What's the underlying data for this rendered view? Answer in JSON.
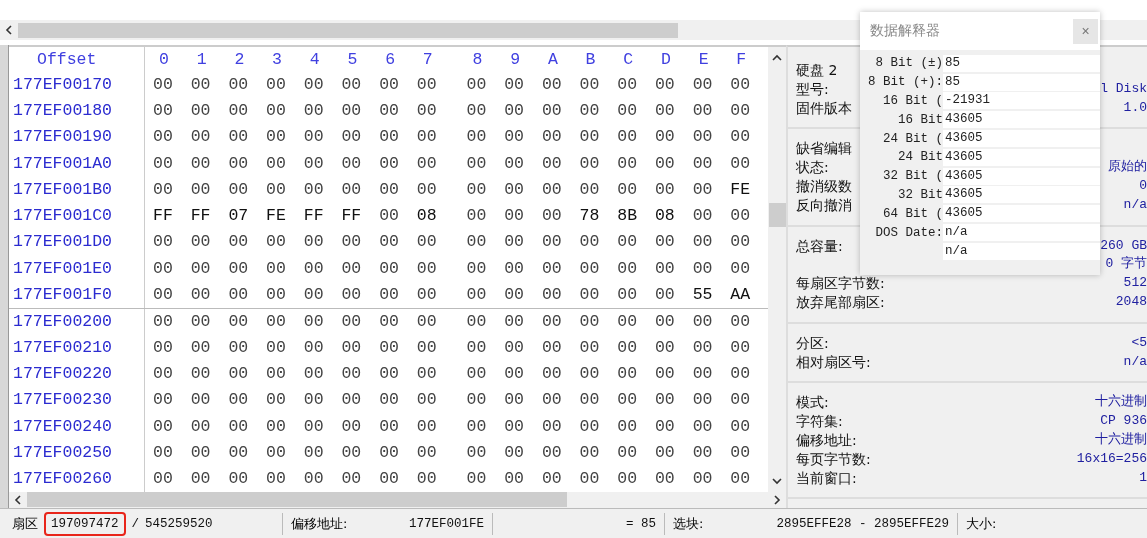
{
  "hex_view": {
    "header": "Offset",
    "columns": [
      "0",
      "1",
      "2",
      "3",
      "4",
      "5",
      "6",
      "7",
      "8",
      "9",
      "A",
      "B",
      "C",
      "D",
      "E",
      "F"
    ],
    "rows": [
      {
        "offset": "177EF00170",
        "bytes": [
          "00",
          "00",
          "00",
          "00",
          "00",
          "00",
          "00",
          "00",
          "00",
          "00",
          "00",
          "00",
          "00",
          "00",
          "00",
          "00"
        ]
      },
      {
        "offset": "177EF00180",
        "bytes": [
          "00",
          "00",
          "00",
          "00",
          "00",
          "00",
          "00",
          "00",
          "00",
          "00",
          "00",
          "00",
          "00",
          "00",
          "00",
          "00"
        ]
      },
      {
        "offset": "177EF00190",
        "bytes": [
          "00",
          "00",
          "00",
          "00",
          "00",
          "00",
          "00",
          "00",
          "00",
          "00",
          "00",
          "00",
          "00",
          "00",
          "00",
          "00"
        ]
      },
      {
        "offset": "177EF001A0",
        "bytes": [
          "00",
          "00",
          "00",
          "00",
          "00",
          "00",
          "00",
          "00",
          "00",
          "00",
          "00",
          "00",
          "00",
          "00",
          "00",
          "00"
        ]
      },
      {
        "offset": "177EF001B0",
        "bytes": [
          "00",
          "00",
          "00",
          "00",
          "00",
          "00",
          "00",
          "00",
          "00",
          "00",
          "00",
          "00",
          "00",
          "00",
          "00",
          "FE"
        ]
      },
      {
        "offset": "177EF001C0",
        "bytes": [
          "FF",
          "FF",
          "07",
          "FE",
          "FF",
          "FF",
          "00",
          "08",
          "00",
          "00",
          "00",
          "78",
          "8B",
          "08",
          "00",
          "00"
        ]
      },
      {
        "offset": "177EF001D0",
        "bytes": [
          "00",
          "00",
          "00",
          "00",
          "00",
          "00",
          "00",
          "00",
          "00",
          "00",
          "00",
          "00",
          "00",
          "00",
          "00",
          "00"
        ]
      },
      {
        "offset": "177EF001E0",
        "bytes": [
          "00",
          "00",
          "00",
          "00",
          "00",
          "00",
          "00",
          "00",
          "00",
          "00",
          "00",
          "00",
          "00",
          "00",
          "00",
          "00"
        ]
      },
      {
        "offset": "177EF001F0",
        "bytes": [
          "00",
          "00",
          "00",
          "00",
          "00",
          "00",
          "00",
          "00",
          "00",
          "00",
          "00",
          "00",
          "00",
          "00",
          "55",
          "AA"
        ]
      },
      {
        "offset": "177EF00200",
        "bytes": [
          "00",
          "00",
          "00",
          "00",
          "00",
          "00",
          "00",
          "00",
          "00",
          "00",
          "00",
          "00",
          "00",
          "00",
          "00",
          "00"
        ]
      },
      {
        "offset": "177EF00210",
        "bytes": [
          "00",
          "00",
          "00",
          "00",
          "00",
          "00",
          "00",
          "00",
          "00",
          "00",
          "00",
          "00",
          "00",
          "00",
          "00",
          "00"
        ]
      },
      {
        "offset": "177EF00220",
        "bytes": [
          "00",
          "00",
          "00",
          "00",
          "00",
          "00",
          "00",
          "00",
          "00",
          "00",
          "00",
          "00",
          "00",
          "00",
          "00",
          "00"
        ]
      },
      {
        "offset": "177EF00230",
        "bytes": [
          "00",
          "00",
          "00",
          "00",
          "00",
          "00",
          "00",
          "00",
          "00",
          "00",
          "00",
          "00",
          "00",
          "00",
          "00",
          "00"
        ]
      },
      {
        "offset": "177EF00240",
        "bytes": [
          "00",
          "00",
          "00",
          "00",
          "00",
          "00",
          "00",
          "00",
          "00",
          "00",
          "00",
          "00",
          "00",
          "00",
          "00",
          "00"
        ]
      },
      {
        "offset": "177EF00250",
        "bytes": [
          "00",
          "00",
          "00",
          "00",
          "00",
          "00",
          "00",
          "00",
          "00",
          "00",
          "00",
          "00",
          "00",
          "00",
          "00",
          "00"
        ]
      },
      {
        "offset": "177EF00260",
        "bytes": [
          "00",
          "00",
          "00",
          "00",
          "00",
          "00",
          "00",
          "00",
          "00",
          "00",
          "00",
          "00",
          "00",
          "00",
          "00",
          "00"
        ]
      }
    ]
  },
  "info_panel": {
    "sections": [
      {
        "items": [
          {
            "label": "硬盘 2"
          },
          {
            "label": "型号:",
            "value": "l Disk"
          },
          {
            "label": "固件版本",
            "value": "1.0"
          }
        ]
      },
      {
        "items": [
          {
            "label": "缺省编辑"
          },
          {
            "label": "状态:",
            "value": "原始的"
          },
          {
            "label": "撤消级数",
            "value": "0"
          },
          {
            "label": "反向撤消",
            "value": "n/a"
          }
        ]
      },
      {
        "items": [
          {
            "label": "总容量:",
            "value": "260 GB"
          },
          {
            "value": "0 字节"
          },
          {
            "label": "每扇区字节数:",
            "value": "512"
          },
          {
            "label": "放弃尾部扇区:",
            "value": "2048"
          }
        ]
      },
      {
        "items": [
          {
            "label": "分区:",
            "value": "<5"
          },
          {
            "label": "相对扇区号:",
            "value": "n/a"
          }
        ]
      },
      {
        "items": [
          {
            "label": "模式:",
            "value": "十六进制"
          },
          {
            "label": "字符集:",
            "value": "CP 936"
          },
          {
            "label": "偏移地址:",
            "value": "十六进制"
          },
          {
            "label": "每页字节数:",
            "value": "16x16=256"
          },
          {
            "label": "当前窗口:",
            "value": "1"
          }
        ]
      }
    ]
  },
  "data_interpreter": {
    "title": "数据解释器",
    "close": "×",
    "rows": [
      {
        "label": "8 Bit (±)",
        "value": "85"
      },
      {
        "label": "8 Bit (+):",
        "value": "85"
      },
      {
        "label": "16 Bit (",
        "value": "-21931"
      },
      {
        "label": "16 Bit",
        "value": "43605"
      },
      {
        "label": "24 Bit (",
        "value": "43605"
      },
      {
        "label": "24 Bit",
        "value": "43605"
      },
      {
        "label": "32 Bit (",
        "value": "43605"
      },
      {
        "label": "32 Bit",
        "value": "43605"
      },
      {
        "label": "64 Bit (",
        "value": "43605"
      },
      {
        "label": "DOS Date:",
        "value": "n/a"
      },
      {
        "value": "n/a"
      }
    ]
  },
  "status_bar": {
    "sector_label": "扇区",
    "sector": "197097472",
    "separator": "/",
    "sector_total": "545259520",
    "sector_highlighted": true,
    "offset_label": "偏移地址:",
    "offset": "177EF001FE",
    "value": "= 85",
    "selection_label": "选块:",
    "selection": "2895EFFE28 - 2895EFFE29",
    "size_label": "大小:"
  }
}
